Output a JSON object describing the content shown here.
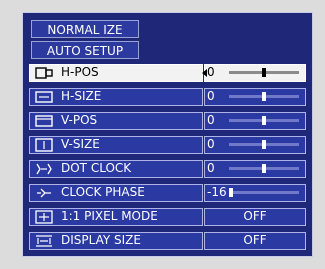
{
  "menu": {
    "buttons": [
      {
        "label": "NORMAL IZE"
      },
      {
        "label": "AUTO SETUP"
      }
    ],
    "items": [
      {
        "label": "H-POS",
        "value": "0",
        "type": "slider",
        "level": 0.5,
        "icon": "h-pos-icon",
        "selected": true
      },
      {
        "label": "H-SIZE",
        "value": "0",
        "type": "slider",
        "level": 0.5,
        "icon": "h-size-icon"
      },
      {
        "label": "V-POS",
        "value": "0",
        "type": "slider",
        "level": 0.5,
        "icon": "v-pos-icon"
      },
      {
        "label": "V-SIZE",
        "value": "0",
        "type": "slider",
        "level": 0.5,
        "icon": "v-size-icon"
      },
      {
        "label": "DOT CLOCK",
        "value": "0",
        "type": "slider",
        "level": 0.5,
        "icon": "dot-clock-icon"
      },
      {
        "label": "CLOCK PHASE",
        "value": "-16",
        "type": "slider",
        "level": 0.0,
        "icon": "clock-phase-icon"
      },
      {
        "label": "1:1 PIXEL MODE",
        "value": "OFF",
        "type": "option",
        "icon": "pixel-mode-icon"
      },
      {
        "label": "DISPLAY SIZE",
        "value": "OFF",
        "type": "option",
        "icon": "display-size-icon"
      }
    ]
  }
}
